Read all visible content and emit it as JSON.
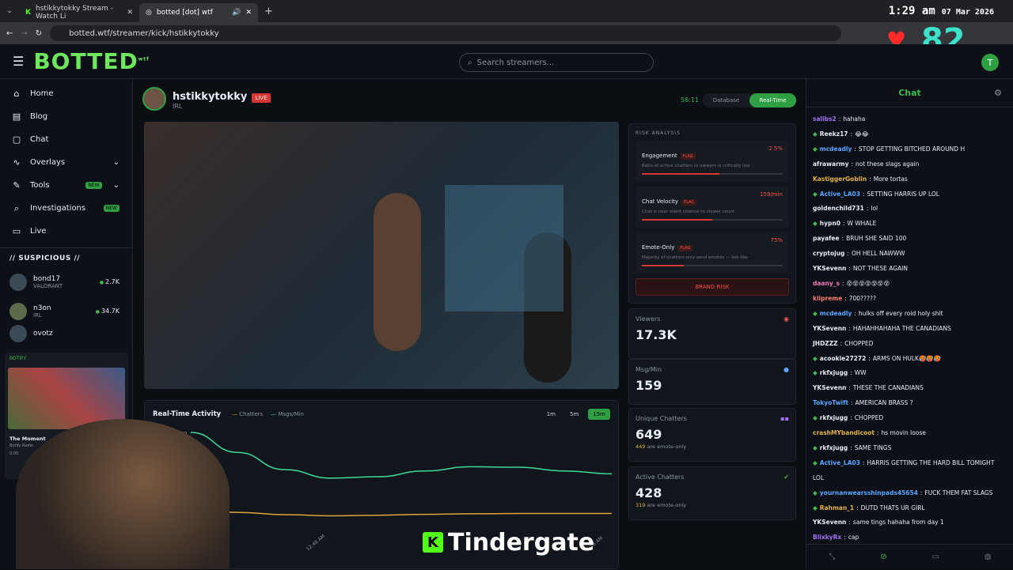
{
  "browser": {
    "tab1": "hstikkytokky Stream - Watch Li",
    "tab2": "botted [dot] wtf",
    "url": "botted.wtf/streamer/kick/hstikkytokky"
  },
  "clock": {
    "time": "1:29 am",
    "date": "07 Mar 2026"
  },
  "overlay": {
    "hearts": "82",
    "caption": "Tindergate",
    "k": "K"
  },
  "app": {
    "logo": "BOTTED",
    "logo_sup": "wtf",
    "search_placeholder": "Search streamers...",
    "user_initial": "T"
  },
  "nav": [
    {
      "label": "Home",
      "icon": "home-icon"
    },
    {
      "label": "Blog",
      "icon": "document-icon"
    },
    {
      "label": "Chat",
      "icon": "chat-icon"
    },
    {
      "label": "Overlays",
      "icon": "pulse-icon"
    },
    {
      "label": "Tools",
      "icon": "wrench-icon",
      "badge": "NEW"
    },
    {
      "label": "Investigations",
      "icon": "search-icon",
      "badge": "NEW"
    },
    {
      "label": "Live",
      "icon": "tv-icon"
    }
  ],
  "suspicious": {
    "title": "// SUSPICIOUS //",
    "items": [
      {
        "name": "bond17",
        "category": "VALORANT",
        "count": "2.7K"
      },
      {
        "name": "n3on",
        "category": "IRL",
        "count": "34.7K"
      },
      {
        "name": "ovotz",
        "category": "",
        "count": "..."
      }
    ]
  },
  "botify": {
    "title": "BOTIFY",
    "song": "The Moment",
    "artist": "Botify Radio",
    "time": "0:00"
  },
  "stream": {
    "name": "hstikkytokky",
    "live": "LIVE",
    "category": "IRL",
    "timer": "56:11",
    "mode_db": "Database",
    "mode_rt": "Real-Time"
  },
  "risk": {
    "title": "RISK ANALYSIS",
    "cards": [
      {
        "name": "Engagement",
        "flag": "FLAG",
        "value": "2.5%",
        "desc": "Ratio of active chatters to viewers is critically low",
        "fill": 0.55
      },
      {
        "name": "Chat Velocity",
        "flag": "FLAG",
        "value": "159/min",
        "desc": "Chat is near silent relative to viewer count",
        "fill": 0.5
      },
      {
        "name": "Emote-Only",
        "flag": "FLAG",
        "value": "75%",
        "desc": "Majority of chatters only send emotes — bot-like",
        "fill": 0.3
      }
    ],
    "brand": "BRAND RISK"
  },
  "stats": [
    {
      "label": "Viewers",
      "value": "17.3K",
      "sub_num": "",
      "sub": ""
    },
    {
      "label": "Msg/Min",
      "value": "159",
      "sub_num": "",
      "sub": ""
    },
    {
      "label": "Unique Chatters",
      "value": "649",
      "sub_num": "449",
      "sub": "are emote-only"
    },
    {
      "label": "Active Chatters",
      "value": "428",
      "sub_num": "319",
      "sub": "are emote-only"
    }
  ],
  "activity": {
    "title": "Real-Time Activity",
    "legend": [
      "Chatters",
      "Msgs/Min"
    ],
    "ranges": [
      "1m",
      "5m",
      "15m"
    ],
    "y_tick": "360",
    "x_ticks": [
      "12:48 AM",
      "1:28 AM"
    ]
  },
  "chart_data": {
    "type": "line",
    "x": [
      0,
      1,
      2,
      3,
      4,
      5,
      6,
      7,
      8,
      9
    ],
    "ylim": [
      0,
      360
    ],
    "series": [
      {
        "name": "Msgs/Min",
        "values": [
          360,
          290,
          230,
          200,
          205,
          225,
          240,
          238,
          225,
          215
        ],
        "color": "#3ddc97"
      },
      {
        "name": "Chatters",
        "values": [
          85,
          80,
          72,
          68,
          70,
          73,
          75,
          76,
          76,
          76
        ],
        "color": "#e3a33a"
      }
    ]
  },
  "chat": {
    "title": "Chat",
    "messages": [
      {
        "user": "salibs2",
        "text": "hahaha",
        "color": "#a371f7",
        "gem": false
      },
      {
        "user": "Reekz17",
        "text": "😂😂",
        "color": "#e6edf3",
        "gem": true
      },
      {
        "user": "mcdeadly",
        "text": "STOP GETTING BITCHED AROUND H",
        "color": "#58a6ff",
        "gem": true
      },
      {
        "user": "afrawarmy",
        "text": "not these slags again",
        "color": "#e6edf3",
        "gem": false
      },
      {
        "user": "KastiggerGoblin",
        "text": "More tortas",
        "color": "#e3b341",
        "gem": false
      },
      {
        "user": "Active_LA03",
        "text": "SETTING HARRIS UP LOL",
        "color": "#58a6ff",
        "gem": true
      },
      {
        "user": "goldenchild731",
        "text": "lol",
        "color": "#e6edf3",
        "gem": false
      },
      {
        "user": "hypn0",
        "text": "W WHALE",
        "color": "#e6edf3",
        "gem": true
      },
      {
        "user": "payafee",
        "text": "BRUH SHE SAID 100",
        "color": "#e6edf3",
        "gem": false
      },
      {
        "user": "cryptojug",
        "text": "OH HELL NAWWW",
        "color": "#e6edf3",
        "gem": false
      },
      {
        "user": "YKSevenn",
        "text": "NOT THESE AGAIN",
        "color": "#e6edf3",
        "gem": false
      },
      {
        "user": "daany_s",
        "text": "😵😵😵😵😵😵😵",
        "color": "#f778ba",
        "gem": false
      },
      {
        "user": "kiipreme",
        "text": "700?????",
        "color": "#ff7b72",
        "gem": false
      },
      {
        "user": "mcdeadly",
        "text": "hulks off every roid holy shit",
        "color": "#58a6ff",
        "gem": true
      },
      {
        "user": "YKSevenn",
        "text": "HAHAHHAHAHA THE CANADIANS",
        "color": "#e6edf3",
        "gem": false
      },
      {
        "user": "JHDZZZ",
        "text": "CHOPPED",
        "color": "#e6edf3",
        "gem": false
      },
      {
        "user": "acookie27272",
        "text": "ARMS ON HULK🥵🥵🥵",
        "color": "#e6edf3",
        "gem": true
      },
      {
        "user": "rkfxjugg",
        "text": "WW",
        "color": "#e6edf3",
        "gem": true
      },
      {
        "user": "YKSevenn",
        "text": "THESE THE CANADIANS",
        "color": "#e6edf3",
        "gem": false
      },
      {
        "user": "TokyoTwift",
        "text": "AMERICAN BRASS ?",
        "color": "#58a6ff",
        "gem": false
      },
      {
        "user": "rkfxjugg",
        "text": "CHOPPED",
        "color": "#e6edf3",
        "gem": true
      },
      {
        "user": "crashMYbandicoot",
        "text": "hs movin loose",
        "color": "#e3b341",
        "gem": false
      },
      {
        "user": "rkfxjugg",
        "text": "SAME TINGS",
        "color": "#e6edf3",
        "gem": true
      },
      {
        "user": "Active_LA03",
        "text": "HARRIS GETTING THE HARD BILL TOMIGHT",
        "color": "#58a6ff",
        "gem": true
      },
      {
        "user": "",
        "text": "LOL",
        "color": "#e6edf3",
        "gem": false
      },
      {
        "user": "yournanwearsshinpads45654",
        "text": "FUCK THEM FAT SLAGS",
        "color": "#58a6ff",
        "gem": true
      },
      {
        "user": "Rahman_1",
        "text": "DUTD THATS UR GIRL",
        "color": "#e3b341",
        "gem": true
      },
      {
        "user": "YKSevenn",
        "text": "same tings hahaha from day 1",
        "color": "#e6edf3",
        "gem": false
      },
      {
        "user": "BlixkyRx",
        "text": "cap",
        "color": "#a371f7",
        "gem": false
      }
    ]
  }
}
